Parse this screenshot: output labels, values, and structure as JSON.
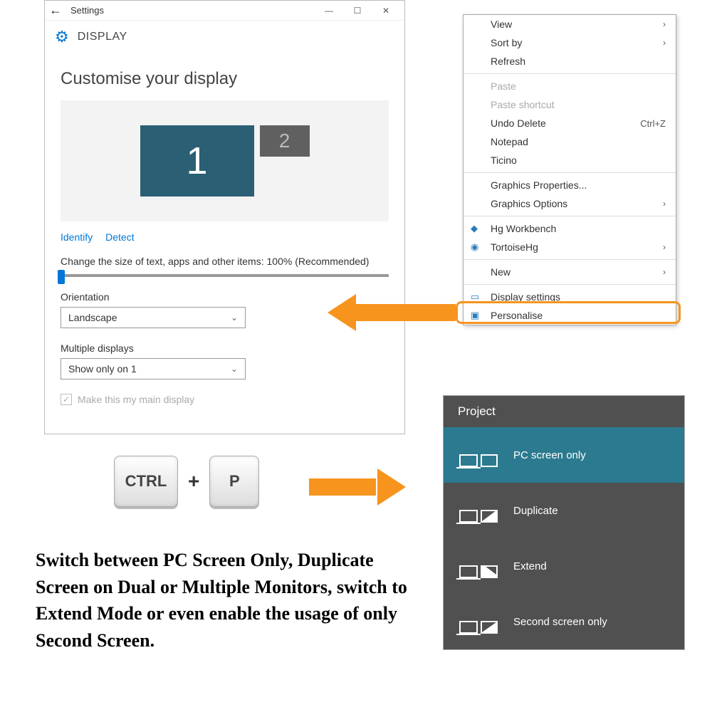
{
  "settings": {
    "title": "Settings",
    "header": "DISPLAY",
    "heading": "Customise your display",
    "monitor1": "1",
    "monitor2": "2",
    "identify": "Identify",
    "detect": "Detect",
    "size_label": "Change the size of text, apps and other items: 100% (Recommended)",
    "orientation_label": "Orientation",
    "orientation_value": "Landscape",
    "multiple_label": "Multiple displays",
    "multiple_value": "Show only on 1",
    "main_display": "Make this my main display"
  },
  "context": {
    "view": "View",
    "sort": "Sort by",
    "refresh": "Refresh",
    "paste": "Paste",
    "paste_shortcut": "Paste shortcut",
    "undo": "Undo Delete",
    "undo_key": "Ctrl+Z",
    "notepad": "Notepad",
    "ticino": "Ticino",
    "gprops": "Graphics Properties...",
    "gopts": "Graphics Options",
    "hg": "Hg Workbench",
    "thg": "TortoiseHg",
    "new": "New",
    "display": "Display settings",
    "personalise": "Personalise"
  },
  "keys": {
    "ctrl": "CTRL",
    "plus": "+",
    "p": "P"
  },
  "project": {
    "title": "Project",
    "opt1": "PC screen only",
    "opt2": "Duplicate",
    "opt3": "Extend",
    "opt4": "Second screen only"
  },
  "caption": "Switch between PC Screen Only, Duplicate Screen on Dual or Multiple Monitors, switch to Extend Mode or even enable the usage of only Second Screen."
}
